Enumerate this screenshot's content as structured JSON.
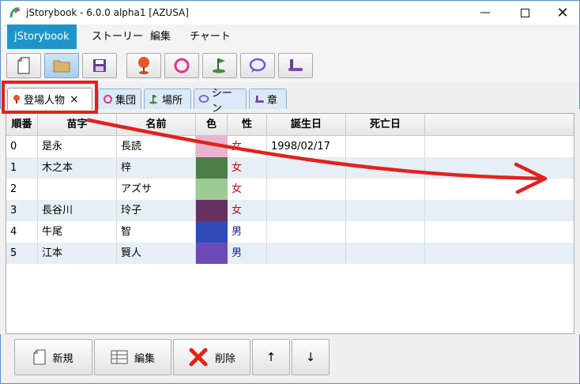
{
  "window": {
    "title": "jStorybook - 6.0.0 alpha1 [AZUSA]"
  },
  "menu": [
    {
      "label": "jStorybook",
      "active": true
    },
    {
      "label": "ストーリー"
    },
    {
      "label": "編集"
    },
    {
      "label": "チャート"
    }
  ],
  "tabs": [
    {
      "label": "登場人物",
      "icon": "person-pin-icon",
      "selected": true,
      "close": "×"
    },
    {
      "label": "集団",
      "icon": "group-ring-icon"
    },
    {
      "label": "場所",
      "icon": "flag-icon"
    },
    {
      "label": "シーン",
      "icon": "speech-bubble-icon"
    },
    {
      "label": "章",
      "icon": "chapter-icon"
    }
  ],
  "table": {
    "columns": [
      "順番",
      "苗字",
      "名前",
      "色",
      "性",
      "誕生日",
      "死亡日"
    ],
    "rows": [
      {
        "order": "0",
        "surname": "是永",
        "name": "長読",
        "color": "#e8b4cf",
        "sex": "女",
        "birth": "1998/02/17",
        "death": ""
      },
      {
        "order": "1",
        "surname": "木之本",
        "name": "梓",
        "color": "#4e7e48",
        "sex": "女",
        "birth": "",
        "death": ""
      },
      {
        "order": "2",
        "surname": "",
        "name": "アズサ",
        "color": "#9ecb93",
        "sex": "女",
        "birth": "",
        "death": ""
      },
      {
        "order": "3",
        "surname": "長谷川",
        "name": "玲子",
        "color": "#663160",
        "sex": "女",
        "birth": "",
        "death": ""
      },
      {
        "order": "4",
        "surname": "牛尾",
        "name": "智",
        "color": "#2d4ab8",
        "sex": "男",
        "birth": "",
        "death": ""
      },
      {
        "order": "5",
        "surname": "江本",
        "name": "賢人",
        "color": "#6a4ab7",
        "sex": "男",
        "birth": "",
        "death": ""
      }
    ]
  },
  "buttons": {
    "new": "新規",
    "edit": "編集",
    "delete": "削除",
    "up": "↑",
    "down": "↓"
  },
  "colors": {
    "female": "#d0021b",
    "male": "#1a1aa6",
    "menu_active": "#1e95c8",
    "annotation": "#e3211c"
  }
}
